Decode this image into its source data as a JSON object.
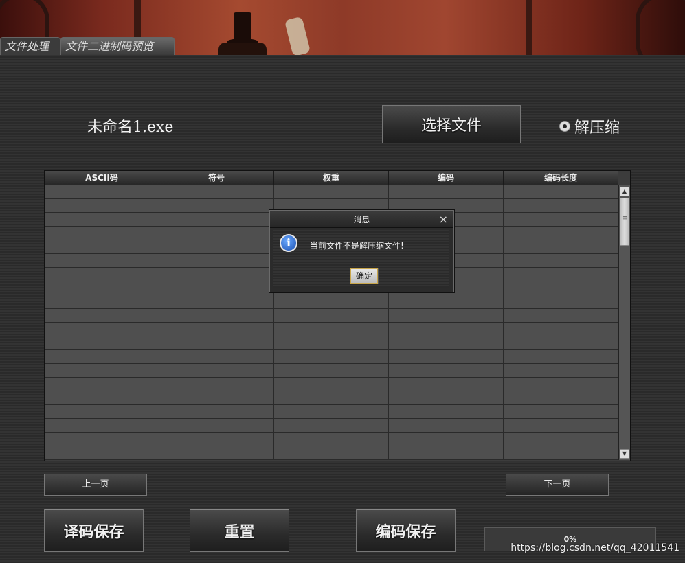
{
  "tabs": [
    {
      "label": "文件处理",
      "active": true
    },
    {
      "label": "文件二进制码预览",
      "active": false
    }
  ],
  "file": {
    "name": "未命名1.exe"
  },
  "select_button": {
    "label": "选择文件"
  },
  "decompress_option": {
    "label": "解压缩",
    "selected": true
  },
  "table": {
    "columns": [
      "ASCII码",
      "符号",
      "权重",
      "编码",
      "编码长度"
    ],
    "visible_rows": 20
  },
  "pagination": {
    "prev_label": "上一页",
    "next_label": "下一页"
  },
  "actions": {
    "decode_save": "译码保存",
    "reset": "重置",
    "encode_save": "编码保存"
  },
  "progress": {
    "value": 0,
    "label": "0%"
  },
  "watermark": "https://blog.csdn.net/qq_42011541",
  "dialog": {
    "title": "消息",
    "close": "×",
    "message": "当前文件不是解压缩文件!",
    "ok_label": "确定"
  },
  "colors": {
    "accent": "#3c7ad6",
    "dialog_button_border": "#c9a64b"
  }
}
